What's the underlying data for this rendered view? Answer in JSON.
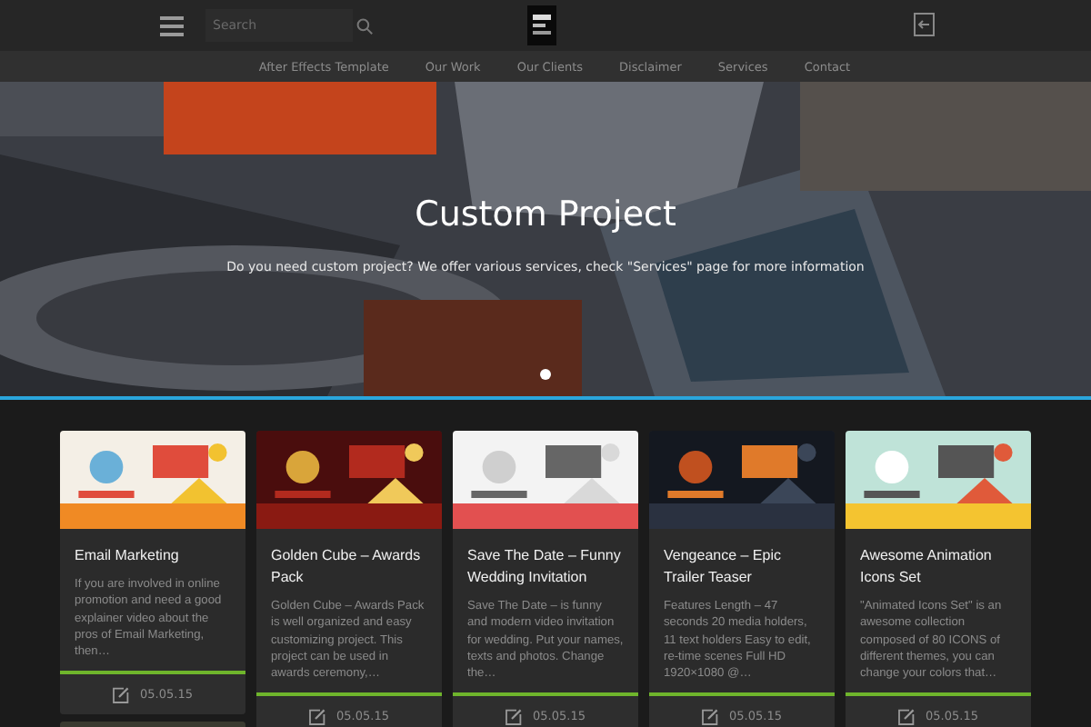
{
  "header": {
    "search": {
      "placeholder": "Search"
    }
  },
  "nav": [
    {
      "label": "After Effects Template"
    },
    {
      "label": "Our Work"
    },
    {
      "label": "Our Clients"
    },
    {
      "label": "Disclaimer"
    },
    {
      "label": "Services"
    },
    {
      "label": "Contact"
    }
  ],
  "hero": {
    "title": "Custom Project",
    "subtitle": "Do you need custom project? We offer various services, check \"Services\" page for more information",
    "dots": [
      {
        "selected": true
      }
    ]
  },
  "columns": [
    {
      "cards": [
        {
          "kind": "card",
          "title": "Email Marketing",
          "excerpt": "If you are involved in online promotion and need a good explainer video about the pros of Email Marketing, then…",
          "date": "05.05.15"
        },
        {
          "kind": "picture"
        }
      ]
    },
    {
      "cards": [
        {
          "kind": "card",
          "title": "Golden Cube – Awards Pack",
          "excerpt": "Golden Cube – Awards Pack is well organized and easy customizing project. This project can be used in awards ceremony,…",
          "date": "05.05.15"
        }
      ]
    },
    {
      "cards": [
        {
          "kind": "card",
          "title": "Save The Date – Funny Wedding Invitation",
          "excerpt": "Save The Date – is funny and modern video invitation for wedding. Put your names, texts and photos. Change the…",
          "date": "05.05.15"
        }
      ]
    },
    {
      "cards": [
        {
          "kind": "card",
          "title": "Vengeance – Epic Trailer Teaser",
          "excerpt": "Features Length – 47 seconds 20 media holders, 11 text holders Easy to edit, re-time scenes Full HD 1920×1080 @…",
          "date": "05.05.15"
        }
      ]
    },
    {
      "cards": [
        {
          "kind": "card",
          "title": "Awesome Animation Icons Set",
          "excerpt": "\"Animated Icons Set\" is an awesome collection composed of 80 ICONS of different themes, you can change your colors that…",
          "date": "05.05.15"
        }
      ]
    }
  ]
}
